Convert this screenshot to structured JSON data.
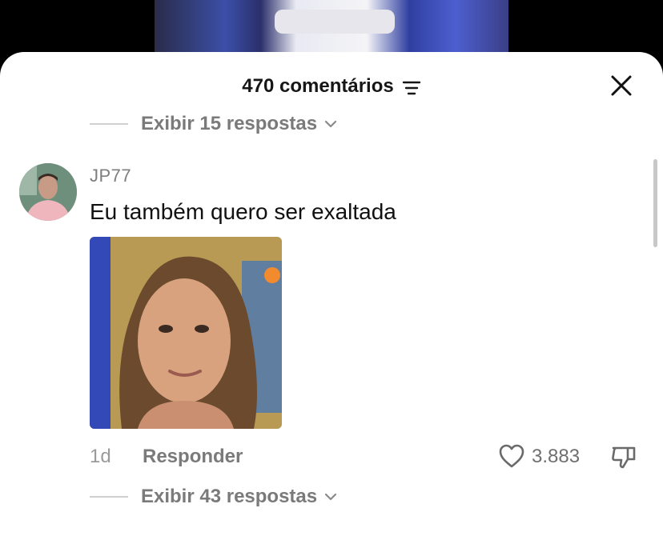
{
  "header": {
    "title": "470 comentários"
  },
  "replies_top": {
    "label": "Exibir 15 respostas"
  },
  "comment": {
    "username": "JP77",
    "text": "Eu também quero ser exaltada",
    "time": "1d",
    "reply_label": "Responder",
    "likes": "3.883"
  },
  "replies_bottom": {
    "label": "Exibir 43 respostas"
  },
  "icons": {
    "filter": "filter-icon",
    "close": "close-icon",
    "chevron": "chevron-down-icon",
    "heart": "heart-icon",
    "dislike": "thumbs-down-icon"
  }
}
